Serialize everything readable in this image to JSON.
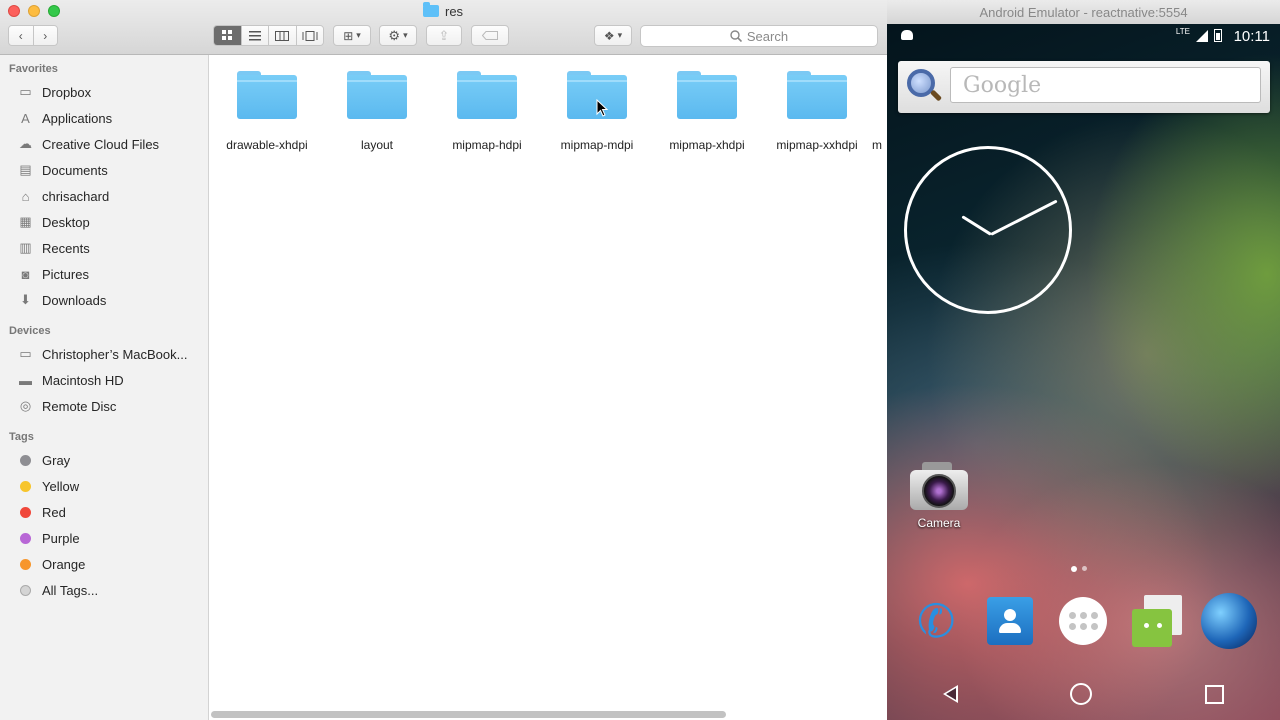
{
  "finder": {
    "window_title": "res",
    "search_placeholder": "Search",
    "sidebar": {
      "favorites_header": "Favorites",
      "favorites": [
        {
          "label": "Dropbox",
          "icon": "dropbox-icon"
        },
        {
          "label": "Applications",
          "icon": "applications-icon"
        },
        {
          "label": "Creative Cloud Files",
          "icon": "creative-cloud-icon"
        },
        {
          "label": "Documents",
          "icon": "documents-icon"
        },
        {
          "label": "chrisachard",
          "icon": "home-icon"
        },
        {
          "label": "Desktop",
          "icon": "desktop-icon"
        },
        {
          "label": "Recents",
          "icon": "recents-icon"
        },
        {
          "label": "Pictures",
          "icon": "pictures-icon"
        },
        {
          "label": "Downloads",
          "icon": "downloads-icon"
        }
      ],
      "devices_header": "Devices",
      "devices": [
        {
          "label": "Christopher’s MacBook...",
          "icon": "laptop-icon"
        },
        {
          "label": "Macintosh HD",
          "icon": "harddrive-icon"
        },
        {
          "label": "Remote Disc",
          "icon": "disc-icon"
        }
      ],
      "tags_header": "Tags",
      "tags": [
        {
          "label": "Gray",
          "color": "#8e8e93"
        },
        {
          "label": "Yellow",
          "color": "#f7c52c"
        },
        {
          "label": "Red",
          "color": "#f0473a"
        },
        {
          "label": "Purple",
          "color": "#b867d6"
        },
        {
          "label": "Orange",
          "color": "#f7962c"
        },
        {
          "label": "All Tags...",
          "color": "#d4d4d4"
        }
      ]
    },
    "folders": [
      "drawable-xhdpi",
      "layout",
      "mipmap-hdpi",
      "mipmap-mdpi",
      "mipmap-xhdpi",
      "mipmap-xxhdpi",
      "m"
    ]
  },
  "emulator": {
    "window_title": "Android Emulator - reactnative:5554",
    "status": {
      "network": "LTE",
      "time": "10:11"
    },
    "search_widget_text": "Google",
    "apps": [
      {
        "label": "Camera",
        "icon": "camera-icon"
      }
    ],
    "dock": [
      {
        "icon": "phone-icon"
      },
      {
        "icon": "contacts-icon"
      },
      {
        "icon": "app-drawer-icon"
      },
      {
        "icon": "messenger-icon"
      },
      {
        "icon": "browser-globe-icon"
      }
    ]
  }
}
